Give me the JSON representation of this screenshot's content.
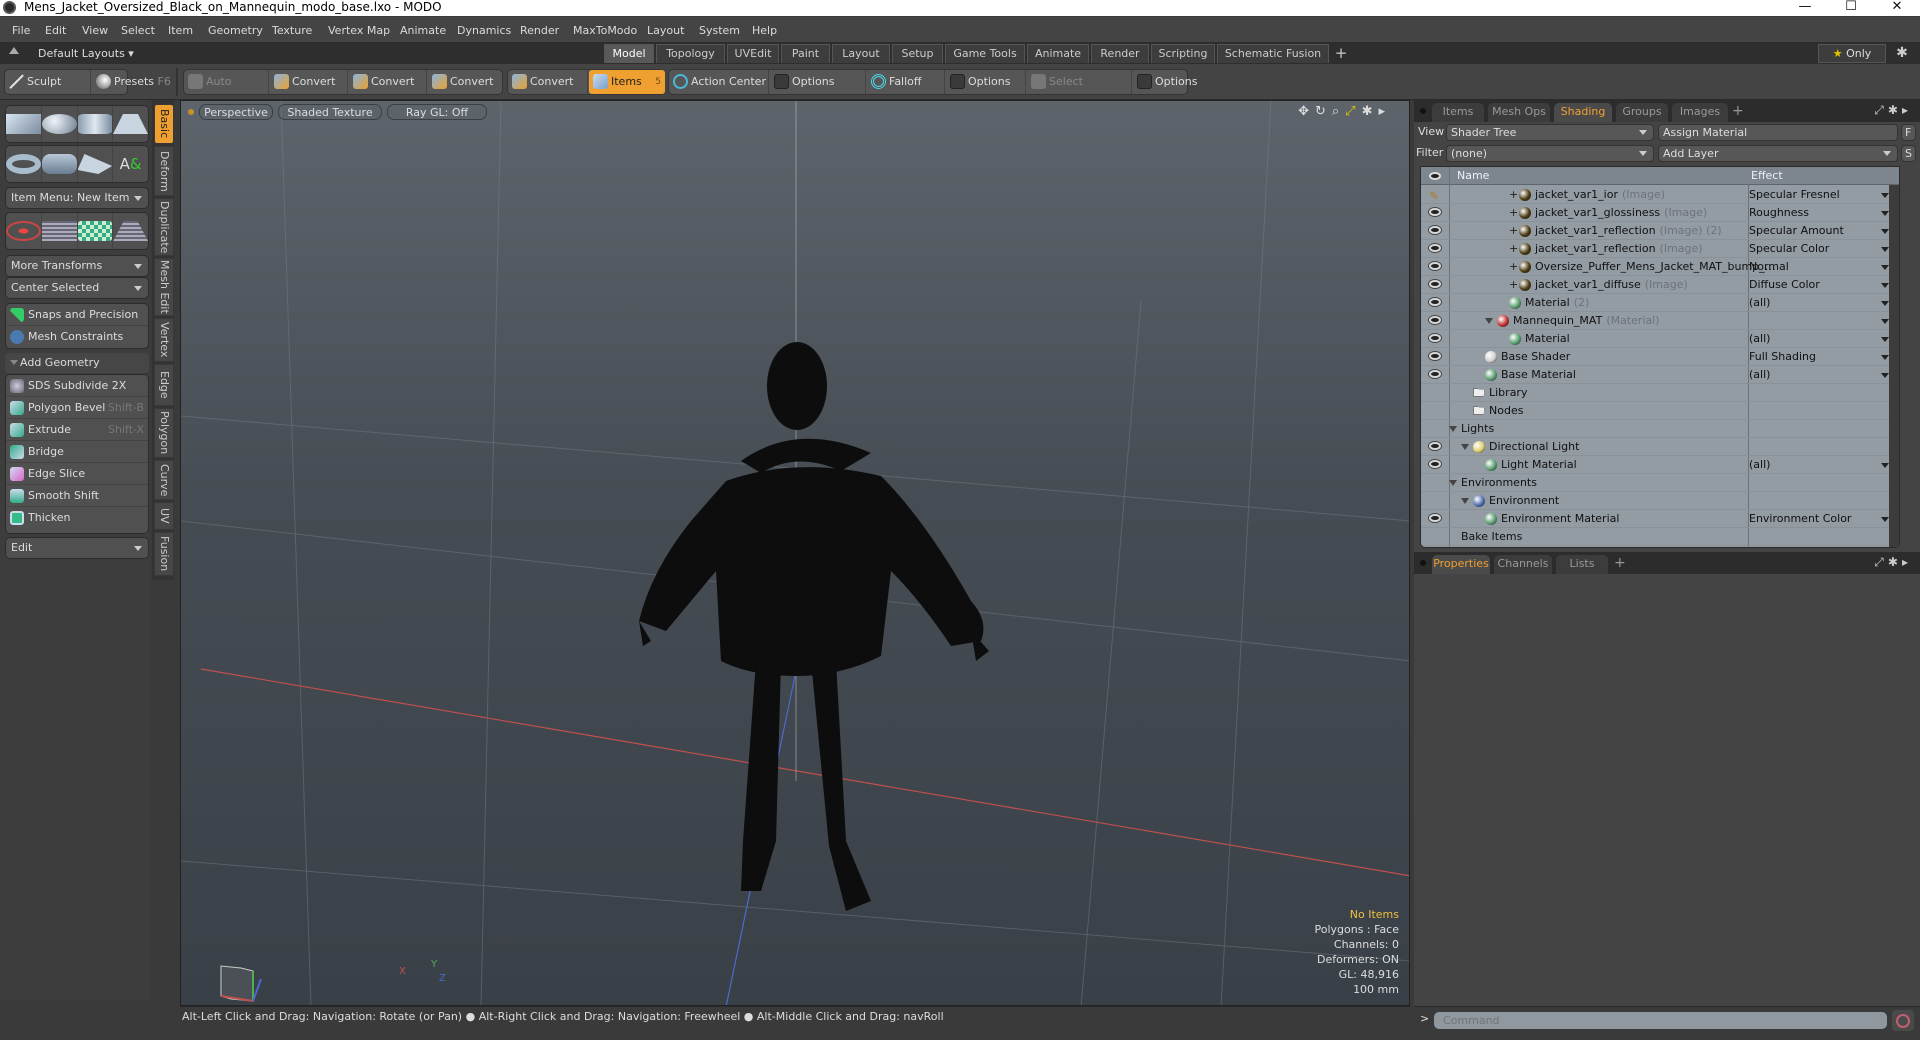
{
  "window": {
    "title": "Mens_Jacket_Oversized_Black_on_Mannequin_modo_base.lxo - MODO",
    "controls": {
      "minimize": "—",
      "maximize": "☐",
      "close": "✕"
    }
  },
  "menubar": [
    "File",
    "Edit",
    "View",
    "Select",
    "Item",
    "Geometry",
    "Texture",
    "Vertex Map",
    "Animate",
    "Dynamics",
    "Render",
    "MaxToModo",
    "Layout",
    "System",
    "Help"
  ],
  "layoutbar": {
    "layouts_label": "Default Layouts ▾",
    "tabs": [
      "Model",
      "Topology",
      "UVEdit",
      "Paint",
      "Layout",
      "Setup",
      "Game Tools",
      "Animate",
      "Render",
      "Scripting",
      "Schematic Fusion"
    ],
    "active_tab": "Model",
    "add_tab": "+",
    "only_label": "Only",
    "star": "★",
    "gear": "✱"
  },
  "toolbar": {
    "sculpt": "Sculpt",
    "presets": "Presets",
    "presets_shortcut": "F6",
    "auto_select": "Auto Select",
    "convert1": "Convert",
    "convert2": "Convert",
    "convert3": "Convert",
    "convert4": "Convert",
    "items": "Items",
    "items_count": "5",
    "action_center": "Action Center",
    "options1": "Options",
    "falloff": "Falloff",
    "options2": "Options",
    "select_through": "Select Through",
    "options3": "Options"
  },
  "left_panel": {
    "vertical_tabs": [
      "Basic",
      "Deform",
      "Duplicate",
      "Mesh Edit",
      "Vertex",
      "Edge",
      "Polygon",
      "Curve",
      "UV",
      "Fusion"
    ],
    "active_vtab": "Basic",
    "item_menu": "Item Menu: New Item",
    "more_transforms": "More Transforms",
    "center_selected": "Center Selected",
    "snaps": "Snaps and Precision",
    "mesh_constraints": "Mesh Constraints",
    "add_geometry": "Add Geometry",
    "tools": [
      {
        "label": "SDS Subdivide 2X",
        "shortcut": ""
      },
      {
        "label": "Polygon Bevel",
        "shortcut": "Shift-B"
      },
      {
        "label": "Extrude",
        "shortcut": "Shift-X"
      },
      {
        "label": "Bridge",
        "shortcut": ""
      },
      {
        "label": "Edge Slice",
        "shortcut": ""
      },
      {
        "label": "Smooth Shift",
        "shortcut": ""
      },
      {
        "label": "Thicken",
        "shortcut": ""
      }
    ],
    "edit_dropdown": "Edit"
  },
  "viewport": {
    "view": "Perspective",
    "shading": "Shaded Texture",
    "raygl": "Ray GL: Off",
    "icons": [
      "move-icon",
      "rotate-icon",
      "zoom-icon",
      "maximize-icon",
      "gear-icon",
      "play-icon"
    ],
    "info": {
      "selection": "No Items",
      "polygons": "Polygons : Face",
      "channels": "Channels: 0",
      "deformers": "Deformers: ON",
      "gl": "GL: 48,916",
      "scale": "100 mm"
    },
    "axis": {
      "x": "X",
      "y": "Y",
      "z": "Z"
    },
    "colors": {
      "x_axis": "#c0504d",
      "y_axis": "#50b050",
      "z_axis": "#4a6ad0"
    }
  },
  "statusbar": {
    "hint1": "Alt-Left Click and Drag: Navigation: Rotate (or Pan)",
    "hint2": "Alt-Right Click and Drag: Navigation: Freewheel",
    "hint3": "Alt-Middle Click and Drag: navRoll",
    "bullet": "●"
  },
  "right_panel": {
    "tabs": [
      "Items",
      "Mesh Ops",
      "Shading",
      "Groups",
      "Images"
    ],
    "active_tab": "Shading",
    "add_tab": "+",
    "view_label": "View",
    "view_value": "Shader Tree",
    "assign_material": "Assign Material",
    "f_button": "F",
    "filter_label": "Filter",
    "filter_value": "(none)",
    "add_layer": "Add Layer",
    "s_button": "S",
    "columns": {
      "name": "Name",
      "effect": "Effect"
    },
    "rows": [
      {
        "name": "jacket_var1_ior",
        "type": "(Image)",
        "effect": "Specular Fresnel",
        "vis": "brush",
        "indent": 4,
        "ball": "#4a3a10",
        "plus": true
      },
      {
        "name": "jacket_var1_glossiness",
        "type": "(Image)",
        "effect": "Roughness",
        "vis": "eye",
        "indent": 4,
        "ball": "#4a3a10",
        "plus": true
      },
      {
        "name": "jacket_var1_reflection",
        "type": "(Image) (2)",
        "effect": "Specular Amount",
        "vis": "eye",
        "indent": 4,
        "ball": "#4a3a10",
        "plus": true
      },
      {
        "name": "jacket_var1_reflection",
        "type": "(Image)",
        "effect": "Specular Color",
        "vis": "eye",
        "indent": 4,
        "ball": "#4a3a10",
        "plus": true
      },
      {
        "name": "Oversize_Puffer_Mens_Jacket_MAT_bump_…",
        "type": "",
        "effect": "Normal",
        "vis": "eye",
        "indent": 4,
        "ball": "#4a3a10",
        "plus": true
      },
      {
        "name": "jacket_var1_diffuse",
        "type": "(Image)",
        "effect": "Diffuse Color",
        "vis": "eye",
        "indent": 4,
        "ball": "#4a3a10",
        "plus": true
      },
      {
        "name": "Material",
        "type": "(2)",
        "effect": "(all)",
        "vis": "eye",
        "indent": 4,
        "ball": "#5aa070",
        "plus": false
      },
      {
        "name": "Mannequin_MAT",
        "type": "(Material)",
        "effect": "",
        "vis": "eye",
        "indent": 3,
        "ball": "#c03030",
        "plus": false,
        "arrow": true
      },
      {
        "name": "Material",
        "type": "",
        "effect": "(all)",
        "vis": "eye",
        "indent": 4,
        "ball": "#5aa070",
        "plus": false
      },
      {
        "name": "Base Shader",
        "type": "",
        "effect": "Full Shading",
        "vis": "eye",
        "indent": 2,
        "ball": "#d0d0d0",
        "plus": false
      },
      {
        "name": "Base Material",
        "type": "",
        "effect": "(all)",
        "vis": "eye",
        "indent": 2,
        "ball": "#5aa070",
        "plus": false
      },
      {
        "name": "Library",
        "type": "",
        "effect": "",
        "vis": "",
        "indent": 1,
        "ball": "folder",
        "plus": false
      },
      {
        "name": "Nodes",
        "type": "",
        "effect": "",
        "vis": "",
        "indent": 1,
        "ball": "folder",
        "plus": false
      },
      {
        "name": "Lights",
        "type": "",
        "effect": "",
        "vis": "",
        "indent": 0,
        "ball": "",
        "plus": false,
        "arrow": true
      },
      {
        "name": "Directional Light",
        "type": "",
        "effect": "",
        "vis": "eye",
        "indent": 1,
        "ball": "#e0d070",
        "plus": false,
        "arrow": true
      },
      {
        "name": "Light Material",
        "type": "",
        "effect": "(all)",
        "vis": "eye",
        "indent": 2,
        "ball": "#5aa070",
        "plus": false
      },
      {
        "name": "Environments",
        "type": "",
        "effect": "",
        "vis": "",
        "indent": 0,
        "ball": "",
        "plus": false,
        "arrow": true
      },
      {
        "name": "Environment",
        "type": "",
        "effect": "",
        "vis": "",
        "indent": 1,
        "ball": "#5070b0",
        "plus": false,
        "arrow": true
      },
      {
        "name": "Environment Material",
        "type": "",
        "effect": "Environment Color",
        "vis": "eye",
        "indent": 2,
        "ball": "#5aa070",
        "plus": false
      },
      {
        "name": "Bake Items",
        "type": "",
        "effect": "",
        "vis": "",
        "indent": 0,
        "ball": "",
        "plus": false
      }
    ],
    "bottom_tabs": [
      "Properties",
      "Channels",
      "Lists"
    ],
    "bottom_active": "Properties"
  },
  "command": {
    "prompt": ">",
    "placeholder": "Command"
  }
}
